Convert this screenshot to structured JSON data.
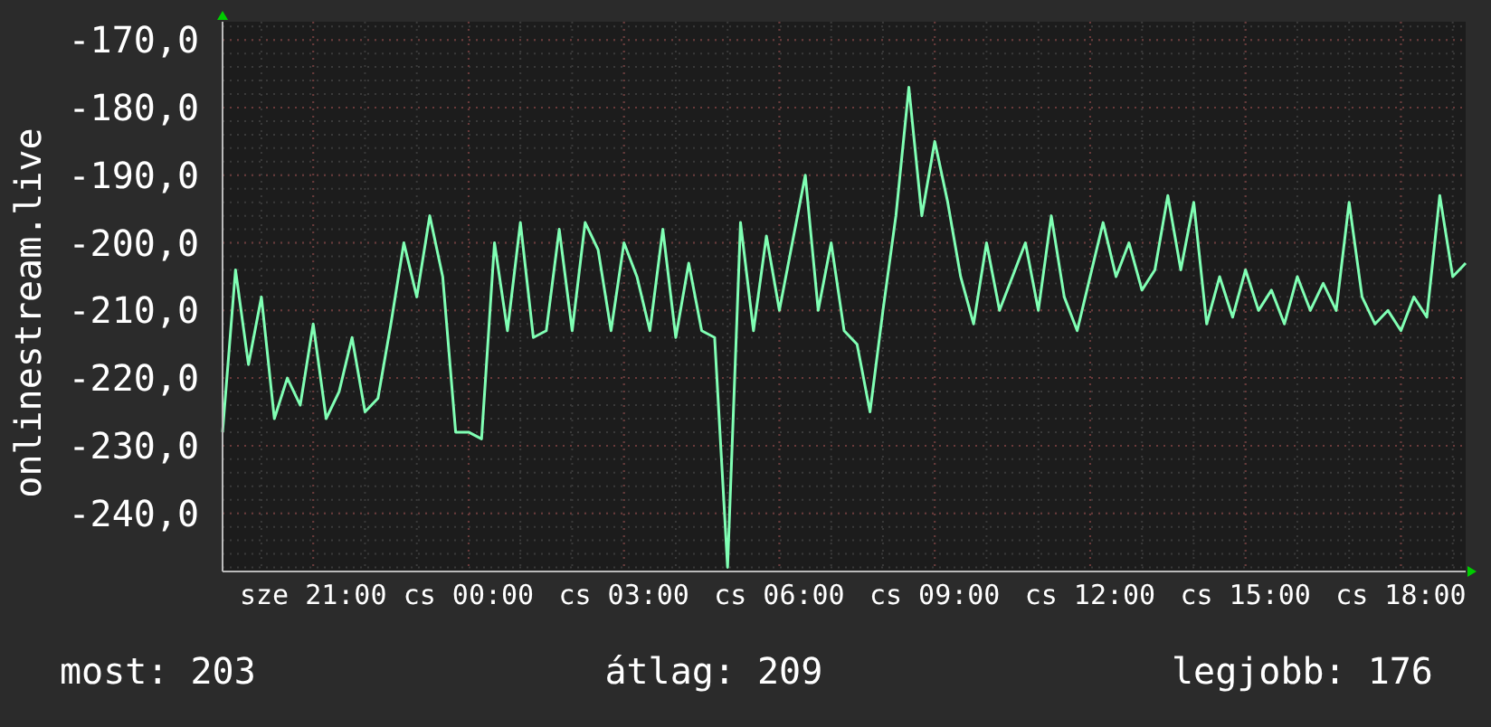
{
  "chart": {
    "chart_data": {
      "type": "line",
      "grid": true,
      "ylabel": "onlinestream.live",
      "ylim": [
        -248.6,
        -167.3
      ],
      "yticks": [
        {
          "value": -170,
          "label": "-170,0"
        },
        {
          "value": -180,
          "label": "-180,0"
        },
        {
          "value": -190,
          "label": "-190,0"
        },
        {
          "value": -200,
          "label": "-200,0"
        },
        {
          "value": -210,
          "label": "-210,0"
        },
        {
          "value": -220,
          "label": "-220,0"
        },
        {
          "value": -230,
          "label": "-230,0"
        },
        {
          "value": -240,
          "label": "-240,0"
        }
      ],
      "categories": [
        null,
        null,
        null,
        null,
        null,
        null,
        null,
        "sze 21:00",
        null,
        null,
        null,
        null,
        null,
        null,
        null,
        null,
        null,
        null,
        null,
        "cs 00:00",
        null,
        null,
        null,
        null,
        null,
        null,
        null,
        null,
        null,
        null,
        null,
        "cs 03:00",
        null,
        null,
        null,
        null,
        null,
        null,
        null,
        null,
        null,
        null,
        null,
        "cs 06:00",
        null,
        null,
        null,
        null,
        null,
        null,
        null,
        null,
        null,
        null,
        null,
        "cs 09:00",
        null,
        null,
        null,
        null,
        null,
        null,
        null,
        null,
        null,
        null,
        null,
        "cs 12:00",
        null,
        null,
        null,
        null,
        null,
        null,
        null,
        null,
        null,
        null,
        null,
        "cs 15:00",
        null,
        null,
        null,
        null,
        null,
        null,
        null,
        null,
        null,
        null,
        null,
        "cs 18:00",
        null,
        null,
        null,
        null,
        null
      ],
      "series": [
        {
          "color": "#80ffb4",
          "values": [
            -228,
            -204,
            -218,
            -208,
            -226,
            -220,
            -224,
            -212,
            -226,
            -222,
            -214,
            -225,
            -223,
            -212,
            -200,
            -208,
            -196,
            -205,
            -228,
            -228,
            -229,
            -200,
            -213,
            -197,
            -214,
            -213,
            -198,
            -213,
            -197,
            -201,
            -213,
            -200,
            -205,
            -213,
            -198,
            -214,
            -203,
            -213,
            -214,
            -248,
            -197,
            -213,
            -199,
            -210,
            -200,
            -190,
            -210,
            -200,
            -213,
            -215,
            -225,
            -210,
            -196,
            -177,
            -196,
            -185,
            -194,
            -205,
            -212,
            -200,
            -210,
            -205,
            -200,
            -210,
            -196,
            -208,
            -213,
            -205,
            -197,
            -205,
            -200,
            -207,
            -204,
            -193,
            -204,
            -194,
            -212,
            -205,
            -211,
            -204,
            -210,
            -207,
            -212,
            -205,
            -210,
            -206,
            -210,
            -194,
            -208,
            -212,
            -210,
            -213,
            -208,
            -211,
            -193,
            -205,
            -203
          ]
        }
      ]
    }
  },
  "footer": [
    {
      "label": "most:",
      "value": "203"
    },
    {
      "label": "átlag:",
      "value": "209"
    },
    {
      "label": "legjobb:",
      "value": "176"
    }
  ]
}
